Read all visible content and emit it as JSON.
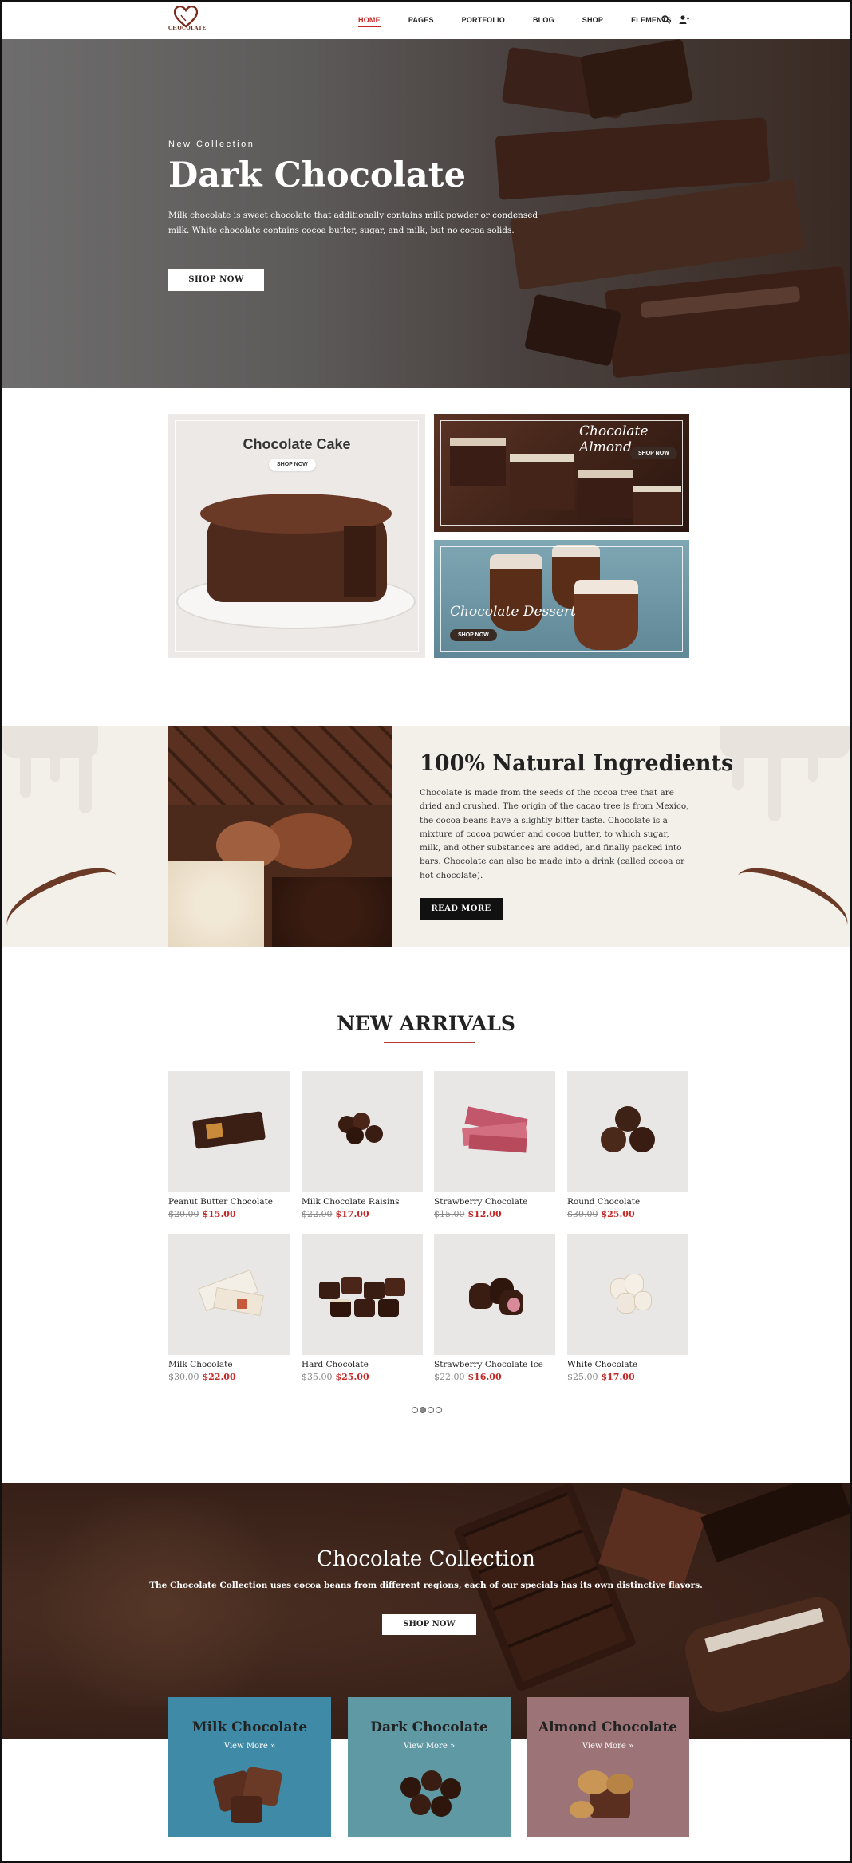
{
  "nav": {
    "logo_text": "CHOCOLATE",
    "menu": [
      "HOME",
      "PAGES",
      "PORTFOLIO",
      "BLOG",
      "SHOP",
      "ELEMENTS"
    ],
    "active_index": 0,
    "icons": [
      "search-icon",
      "user-icon"
    ]
  },
  "hero": {
    "kicker": "New Collection",
    "title": "Dark Chocolate",
    "description": "Milk chocolate is sweet chocolate that additionally contains milk powder or condensed milk. White chocolate contains cocoa butter, sugar, and milk, but no cocoa solids.",
    "button": "SHOP NOW"
  },
  "tiles": {
    "cake": {
      "title": "Chocolate Cake",
      "button": "SHOP NOW"
    },
    "almond": {
      "title": "Chocolate Almond",
      "button": "SHOP NOW"
    },
    "dessert": {
      "title": "Chocolate Dessert",
      "button": "SHOP NOW"
    }
  },
  "natural": {
    "title": "100% Natural Ingredients",
    "text": "Chocolate is made from the seeds of the cocoa tree that are dried and crushed. The origin of the cacao tree is from Mexico, the cocoa beans have a slightly bitter taste. Chocolate is a mixture of cocoa powder and cocoa butter, to which sugar, milk, and other substances are added, and finally packed into bars. Chocolate can also be made into a drink (called cocoa or hot chocolate).",
    "button": "READ MORE"
  },
  "arrivals": {
    "title": "NEW ARRIVALS",
    "products": [
      {
        "name": "Peanut Butter Chocolate",
        "old_price": "$20.00",
        "price": "$15.00"
      },
      {
        "name": "Milk Chocolate Raisins",
        "old_price": "$22.00",
        "price": "$17.00"
      },
      {
        "name": "Strawberry Chocolate",
        "old_price": "$15.00",
        "price": "$12.00"
      },
      {
        "name": "Round Chocolate",
        "old_price": "$30.00",
        "price": "$25.00"
      },
      {
        "name": "Milk Chocolate",
        "old_price": "$30.00",
        "price": "$22.00"
      },
      {
        "name": "Hard Chocolate",
        "old_price": "$35.00",
        "price": "$25.00"
      },
      {
        "name": "Strawberry Chocolate Ice",
        "old_price": "$22.00",
        "price": "$16.00"
      },
      {
        "name": "White Chocolate",
        "old_price": "$25.00",
        "price": "$17.00"
      }
    ],
    "page_count": 4,
    "active_page": 1
  },
  "collection": {
    "title": "Chocolate Collection",
    "subtitle": "The Chocolate Collection uses cocoa beans from different regions, each of our specials has its own distinctive flavors.",
    "button": "SHOP NOW",
    "categories": [
      {
        "title": "Milk Chocolate",
        "link": "View More »",
        "color": "#3f8aa6"
      },
      {
        "title": "Dark Chocolate",
        "link": "View More »",
        "color": "#5f99a3"
      },
      {
        "title": "Almond Chocolate",
        "link": "View More »",
        "color": "#9c7477"
      }
    ]
  },
  "colors": {
    "accent": "#c62828",
    "dark": "#222222",
    "cream": "#f3efe9",
    "chocolate": "#3b231a"
  }
}
